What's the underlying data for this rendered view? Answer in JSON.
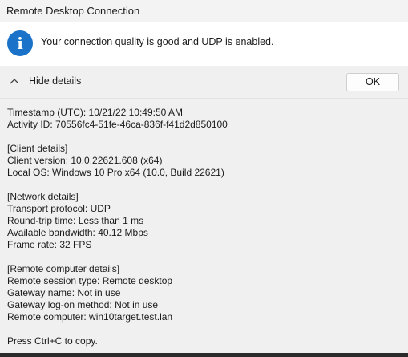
{
  "window": {
    "title": "Remote Desktop Connection"
  },
  "banner": {
    "icon": "info-icon",
    "icon_glyph": "i",
    "message": "Your connection quality is good and UDP is enabled."
  },
  "details_toggle": {
    "label": "Hide details",
    "icon": "chevron-up-icon"
  },
  "ok_button": {
    "label": "OK"
  },
  "details": {
    "timestamp": "Timestamp (UTC): 10/21/22 10:49:50 AM",
    "activity_id": "Activity ID: 70556fc4-51fe-46ca-836f-f41d2d850100",
    "client_header": "[Client details]",
    "client_version": "Client version: 10.0.22621.608 (x64)",
    "local_os": "Local OS: Windows 10 Pro x64 (10.0, Build 22621)",
    "network_header": "[Network details]",
    "transport": "Transport protocol: UDP",
    "rtt": "Round-trip time: Less than 1 ms",
    "bandwidth": "Available bandwidth: 40.12 Mbps",
    "frame_rate": "Frame rate: 32 FPS",
    "remote_header": "[Remote computer details]",
    "session_type": "Remote session type: Remote desktop",
    "gateway_name": "Gateway name: Not in use",
    "gateway_logon": "Gateway log-on method: Not in use",
    "remote_computer": "Remote computer: win10target.test.lan",
    "copy_hint": "Press Ctrl+C to copy."
  },
  "colors": {
    "accent": "#1a73c8",
    "background": "#f0f0f0",
    "banner": "#ffffff"
  }
}
